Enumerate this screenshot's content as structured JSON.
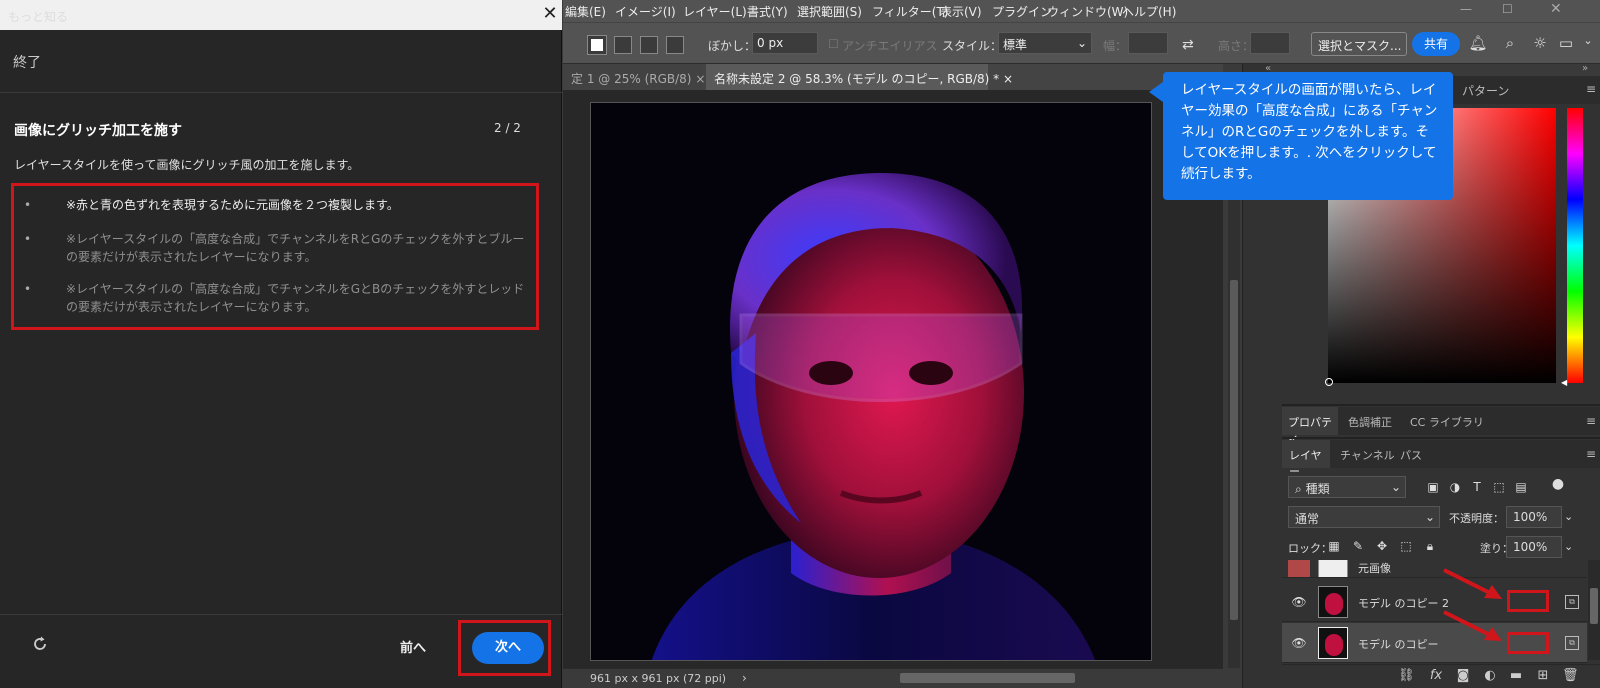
{
  "learn_panel": {
    "window_title": "もっと知る",
    "finish_label": "終了",
    "lesson_title": "画像にグリッチ加工を施す",
    "step": "2 / 2",
    "description": "レイヤースタイルを使って画像にグリッチ風の加工を施します。",
    "bullets": [
      "※赤と青の色ずれを表現するために元画像を２つ複製します。",
      "※レイヤースタイルの「高度な合成」でチャンネルをRとGのチェックを外すとブルーの要素だけが表示されたレイヤーになります。",
      "※レイヤースタイルの「高度な合成」でチャンネルをGとBのチェックを外すとレッドの要素だけが表示されたレイヤーになります。"
    ],
    "prev_label": "前へ",
    "next_label": "次へ"
  },
  "menubar": [
    "編集(E)",
    "イメージ(I)",
    "レイヤー(L)",
    "書式(Y)",
    "選択範囲(S)",
    "フィルター(T)",
    "表示(V)",
    "プラグイン",
    "ウィンドウ(W)",
    "ヘルプ(H)"
  ],
  "options_bar": {
    "feather_label": "ぼかし：",
    "feather_value": "0 px",
    "antialias_label": "アンチエイリアス",
    "style_label": "スタイル：",
    "style_value": "標準",
    "width_label": "幅：",
    "height_label": "高さ：",
    "select_mask_label": "選択とマスク...",
    "share_label": "共有"
  },
  "doc_tabs": {
    "tab1": "定 1 @ 25% (RGB/8)",
    "tab2": "名称未設定 2 @ 58.3% (モデル のコピー, RGB/8) *",
    "close": "×"
  },
  "status_bar": {
    "size": "961 px x 961 px (72 ppi)"
  },
  "tooltip": "レイヤースタイルの画面が開いたら、レイヤー効果の「高度な合成」にある「チャンネル」のRとGのチェックを外します。そしてOKを押します。. 次へをクリックして続行します。",
  "right_panel": {
    "pattern_tab": "パターン",
    "prop_tabs": [
      "プロパティ",
      "色調補正",
      "CC ライブラリ"
    ],
    "layer_tabs": [
      "レイヤー",
      "チャンネル",
      "パス"
    ],
    "kind_label": "種類",
    "blend_mode": "通常",
    "opacity_label": "不透明度：",
    "opacity_value": "100%",
    "lock_label": "ロック：",
    "fill_label": "塗り：",
    "fill_value": "100%",
    "layers": [
      {
        "name": "元画像"
      },
      {
        "name": "モデル のコピー 2"
      },
      {
        "name": "モデル のコピー"
      }
    ]
  },
  "colors": {
    "accent": "#1473e6",
    "highlight": "#d0161b"
  }
}
